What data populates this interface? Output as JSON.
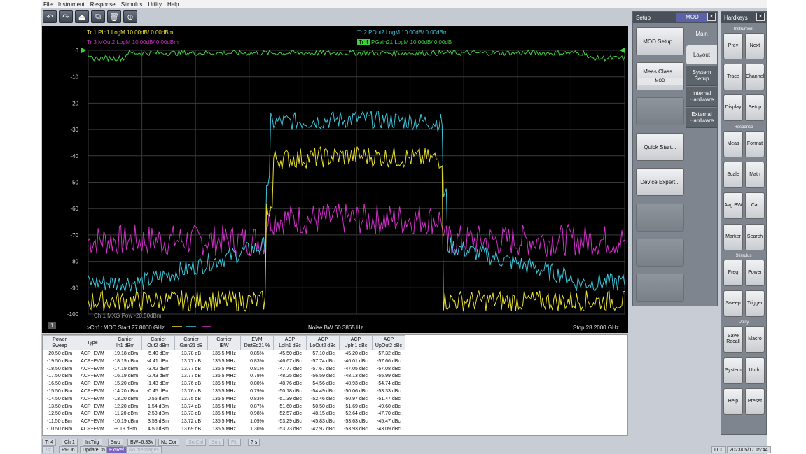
{
  "menu": [
    "File",
    "Instrument",
    "Response",
    "Stimulus",
    "Utility",
    "Help"
  ],
  "toolbar": [
    {
      "name": "undo-button",
      "glyph": "↶"
    },
    {
      "name": "redo-button",
      "glyph": "↷"
    },
    {
      "name": "marker-button",
      "glyph": "⏏"
    },
    {
      "name": "screenshot-button",
      "glyph": "⧉"
    },
    {
      "name": "delete-button",
      "glyph": "🗑"
    },
    {
      "name": "zoom-button",
      "glyph": "⊕"
    }
  ],
  "traces": {
    "tr1": "Tr 1  PIn1 LogM 10.00dB/ 0.00dBm",
    "tr2": "Tr 2  POut2 LogM 10.00dB/ 0.00dBm",
    "tr3": "Tr 3  MOut2 LogM 10.00dB/ 0.00dBm",
    "tr4_tag": "Tr 4",
    "tr4": "PGain21 LogM 10.00dB/ 0.00dB"
  },
  "colors": {
    "yellow": "#e8e030",
    "cyan": "#3cc4d8",
    "magenta": "#d030c8",
    "green": "#3cd03c"
  },
  "plot": {
    "y_ticks": [
      "0",
      "-10",
      "-20",
      "-30",
      "-40",
      "-50",
      "-60",
      "-70",
      "-80",
      "-90",
      "-100"
    ],
    "channel_badge": "1",
    "start": ">Ch1: MOD  Start  27.8000 GHz",
    "noise_bw": "Noise BW  60.3865 Hz",
    "stop": "Stop  28.2000 GHz",
    "overlay": "Ch 1  MXG Pow -20.50dBm"
  },
  "table": {
    "headers": [
      "Power\nSweep",
      "Type",
      "Carrier\nIn1 dBm",
      "Carrier\nOut2 dBm",
      "Carrier\nGain21 dB",
      "Carrier\nIBW",
      "EVM\nDistEq21 %",
      "ACP\nLoIn1 dBc",
      "ACP\nLoOut2 dBc",
      "ACP\nUpIn1 dBc",
      "ACP\nUpOut2 dBc"
    ],
    "rows": [
      [
        "-20.50 dBm",
        "ACP+EVM",
        "-19.18 dBm",
        "-5.40 dBm",
        "13.78 dB",
        "135.5 MHz",
        "0.85%",
        "-45.50 dBc",
        "-57.10 dBc",
        "-45.20 dBc",
        "-57.32 dBc"
      ],
      [
        "-19.50 dBm",
        "ACP+EVM",
        "-18.19 dBm",
        "-4.41 dBm",
        "13.77 dB",
        "135.5 MHz",
        "0.83%",
        "-46.67 dBc",
        "-57.74 dBc",
        "-46.01 dBc",
        "-57.66 dBc"
      ],
      [
        "-18.50 dBm",
        "ACP+EVM",
        "-17.19 dBm",
        "-3.42 dBm",
        "13.77 dB",
        "135.5 MHz",
        "0.81%",
        "-47.77 dBc",
        "-57.67 dBc",
        "-47.05 dBc",
        "-57.08 dBc"
      ],
      [
        "-17.50 dBm",
        "ACP+EVM",
        "-16.19 dBm",
        "-2.43 dBm",
        "13.77 dB",
        "135.5 MHz",
        "0.79%",
        "-48.25 dBc",
        "-56.59 dBc",
        "-48.13 dBc",
        "-55.99 dBc"
      ],
      [
        "-16.50 dBm",
        "ACP+EVM",
        "-15.20 dBm",
        "-1.43 dBm",
        "13.76 dB",
        "135.5 MHz",
        "0.80%",
        "-48.76 dBc",
        "-54.56 dBc",
        "-48.93 dBc",
        "-54.74 dBc"
      ],
      [
        "-15.50 dBm",
        "ACP+EVM",
        "-14.20 dBm",
        "-0.45 dBm",
        "13.76 dB",
        "135.5 MHz",
        "0.79%",
        "-50.18 dBc",
        "-54.49 dBc",
        "-50.06 dBc",
        "-53.33 dBc"
      ],
      [
        "-14.50 dBm",
        "ACP+EVM",
        "-13.20 dBm",
        "0.55 dBm",
        "13.75 dB",
        "135.5 MHz",
        "0.83%",
        "-51.39 dBc",
        "-52.46 dBc",
        "-50.97 dBc",
        "-51.47 dBc"
      ],
      [
        "-13.50 dBm",
        "ACP+EVM",
        "-12.20 dBm",
        "1.54 dBm",
        "13.74 dB",
        "135.5 MHz",
        "0.87%",
        "-51.60 dBc",
        "-50.50 dBc",
        "-51.69 dBc",
        "-49.60 dBc"
      ],
      [
        "-12.50 dBm",
        "ACP+EVM",
        "-11.20 dBm",
        "2.53 dBm",
        "13.73 dB",
        "135.5 MHz",
        "0.98%",
        "-52.57 dBc",
        "-48.15 dBc",
        "-52.64 dBc",
        "-47.70 dBc"
      ],
      [
        "-11.50 dBm",
        "ACP+EVM",
        "-10.19 dBm",
        "3.53 dBm",
        "13.72 dB",
        "135.5 MHz",
        "1.09%",
        "-53.29 dBc",
        "-45.83 dBc",
        "-53.63 dBc",
        "-45.47 dBc"
      ],
      [
        "-10.50 dBm",
        "ACP+EVM",
        "-9.19 dBm",
        "4.50 dBm",
        "13.69 dB",
        "135.5 MHz",
        "1.30%",
        "-53.73 dBc",
        "-42.97 dBc",
        "-53.93 dBc",
        "-43.09 dBc"
      ]
    ]
  },
  "footer": {
    "row1": [
      "Tr 4",
      "Ch 1",
      "IntTrig",
      "Swp",
      "BW=6.33k",
      "No Cor",
      "SrcCal",
      "Smo",
      "Fltr",
      "? s"
    ],
    "row2": [
      "Tst",
      "RFOn",
      "UpdateOn",
      "ExtRef",
      "No messages"
    ],
    "lcl": "LCL",
    "datetime": "2023/05/17 15:44"
  },
  "setup": {
    "title": "Setup",
    "mode": "MOD",
    "softkeys": [
      "MOD Setup...",
      "Meas Class...",
      "",
      "Quick Start...",
      "Device Expert...",
      "",
      "",
      ""
    ],
    "meas_class_value": "MOD",
    "tabs": [
      "Main",
      "Layout",
      "System\nSetup",
      "Internal\nHardware",
      "External\nHardware"
    ]
  },
  "hardkeys": {
    "title": "Hardkeys",
    "sections": {
      "instrument": "Instrument",
      "response": "Response",
      "stimulus": "Stimulus",
      "utility": "Utility"
    },
    "keys": [
      [
        "Prev",
        "Next"
      ],
      [
        "Trace",
        "Channel"
      ],
      [
        "Display",
        "Setup"
      ],
      [
        "Meas",
        "Format"
      ],
      [
        "Scale",
        "Math"
      ],
      [
        "Avg BW",
        "Cal"
      ],
      [
        "Marker",
        "Search"
      ],
      [
        "Freq",
        "Power"
      ],
      [
        "Sweep",
        "Trigger"
      ],
      [
        "Save\nRecall",
        "Macro"
      ],
      [
        "System",
        "Undo"
      ],
      [
        "Help",
        "Preset"
      ]
    ]
  }
}
